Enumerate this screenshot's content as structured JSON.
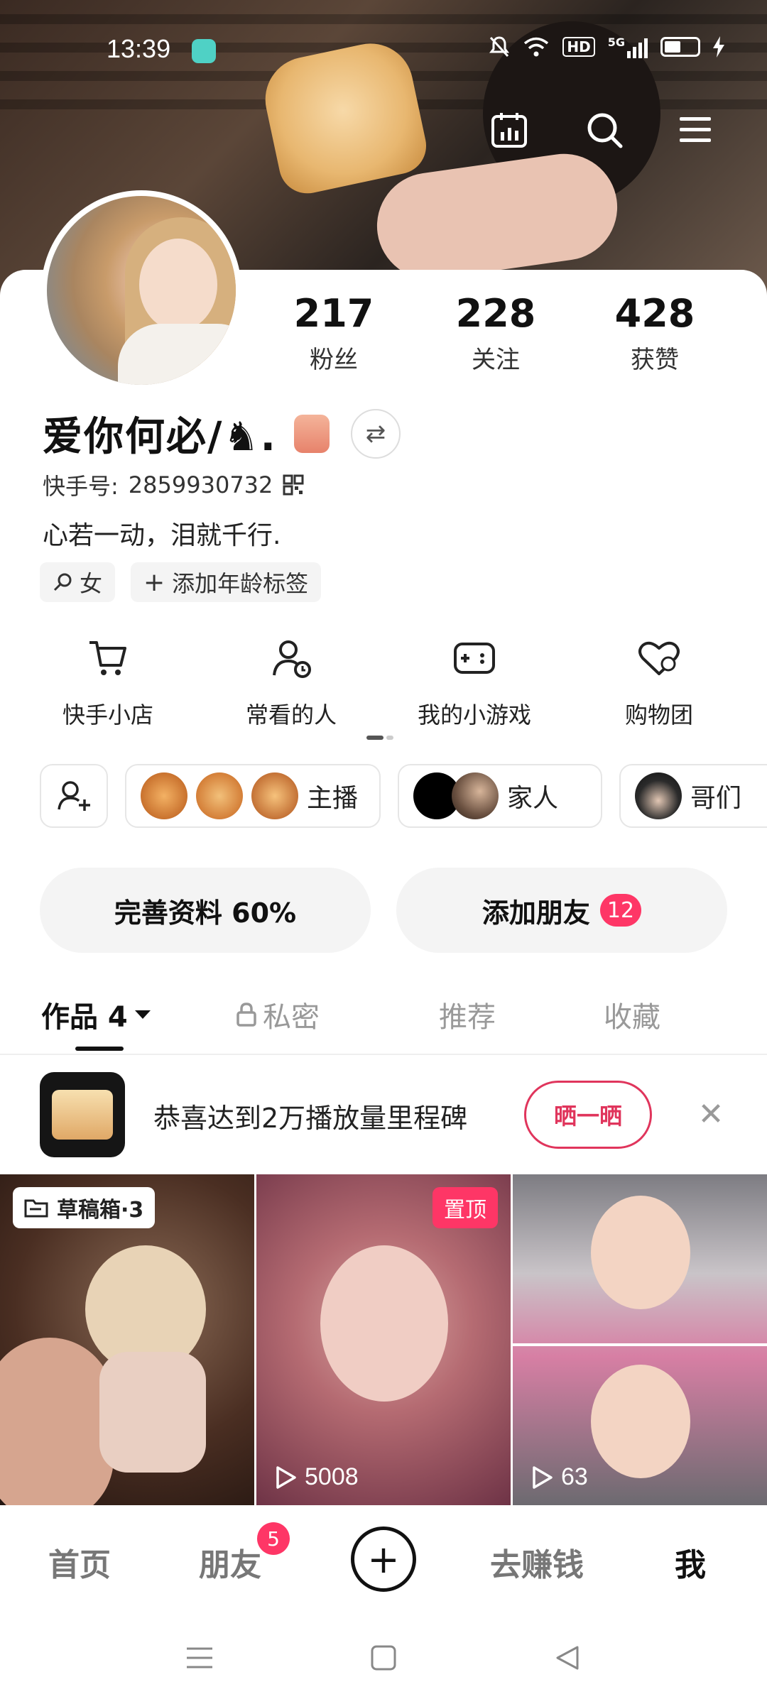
{
  "status_bar": {
    "time": "13:39",
    "hd": "HD",
    "signal": "5G"
  },
  "profile": {
    "nickname": "爱你何必/♞.",
    "kwai_id_label": "快手号:",
    "kwai_id": "2859930732",
    "bio": "心若一动，泪就千行.",
    "tags": {
      "gender": "女",
      "add_age": "添加年龄标签"
    }
  },
  "stats": [
    {
      "value": "217",
      "label": "粉丝"
    },
    {
      "value": "228",
      "label": "关注"
    },
    {
      "value": "428",
      "label": "获赞"
    }
  ],
  "shortcuts": [
    {
      "label": "快手小店",
      "icon": "cart-icon"
    },
    {
      "label": "常看的人",
      "icon": "user-clock-icon"
    },
    {
      "label": "我的小游戏",
      "icon": "gamepad-icon"
    },
    {
      "label": "购物团",
      "icon": "heart-group-icon"
    }
  ],
  "chips": {
    "host": "主播",
    "family": "家人",
    "bros": "哥们"
  },
  "actions": {
    "complete_profile": "完善资料 60%",
    "add_friends": "添加朋友",
    "friends_count": "12"
  },
  "tabs": {
    "works": "作品 4",
    "private": "私密",
    "recommend": "推荐",
    "favorites": "收藏"
  },
  "milestone": {
    "text": "恭喜达到2万播放量里程碑",
    "share_label": "晒一晒"
  },
  "grid": {
    "drafts_label": "草稿箱·3",
    "pinned_label": "置顶",
    "pinned_plays": "5008",
    "third_plays": "63"
  },
  "bottom_nav": {
    "home": "首页",
    "friends": "朋友",
    "friends_badge": "5",
    "earn": "去赚钱",
    "me": "我"
  },
  "colors": {
    "accent": "#fe3666",
    "share_border": "#e0355c"
  }
}
